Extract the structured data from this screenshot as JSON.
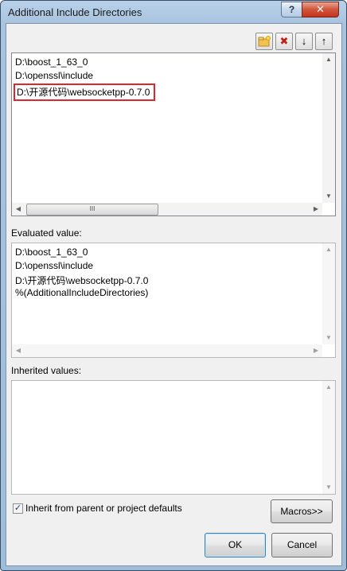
{
  "window": {
    "title": "Additional Include Directories",
    "help_label": "?",
    "close_label": "✕"
  },
  "toolbar": {
    "new_line": "new-folder-icon",
    "delete": "✖",
    "move_down": "↓",
    "move_up": "↑"
  },
  "edit_list": [
    "D:\\boost_1_63_0",
    "D:\\openssl\\include",
    "D:\\开源代码\\websocketpp-0.7.0"
  ],
  "scroll": {
    "up": "▲",
    "down": "▼",
    "left": "◀",
    "right": "▶",
    "grip": "III"
  },
  "evaluated": {
    "label": "Evaluated value:",
    "lines": [
      "D:\\boost_1_63_0",
      "D:\\openssl\\include",
      "D:\\开源代码\\websocketpp-0.7.0",
      "%(AdditionalIncludeDirectories)"
    ]
  },
  "inherited": {
    "label": "Inherited values:"
  },
  "inherit_checkbox": {
    "label": "Inherit from parent or project defaults",
    "checked": true,
    "mark": "✓"
  },
  "buttons": {
    "macros": "Macros>>",
    "ok": "OK",
    "cancel": "Cancel"
  },
  "colors": {
    "highlight_box": "#e0262a",
    "dialog_bg": "#f0f0f0",
    "title_gradient": "#a8c3df"
  }
}
